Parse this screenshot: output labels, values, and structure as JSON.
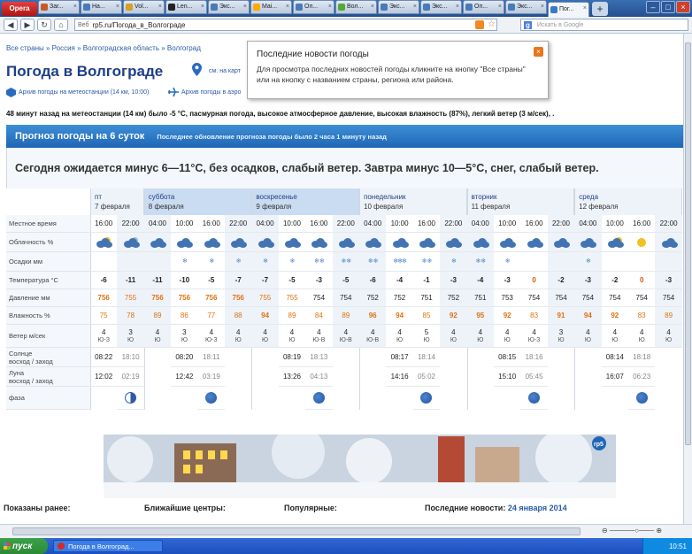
{
  "browser": {
    "menu_label": "Opera",
    "tabs": [
      {
        "label": "Заг...",
        "color": "#c65a2a"
      },
      {
        "label": "На...",
        "color": "#4a7ab8"
      },
      {
        "label": "Vol...",
        "color": "#d8a020"
      },
      {
        "label": "Len...",
        "color": "#222222"
      },
      {
        "label": "Экс...",
        "color": "#4a7ab8"
      },
      {
        "label": "Mai...",
        "color": "#ffaa00"
      },
      {
        "label": "Оп...",
        "color": "#4a7ab8"
      },
      {
        "label": "Вол...",
        "color": "#55aa33"
      },
      {
        "label": "Экс...",
        "color": "#4a7ab8"
      },
      {
        "label": "Экс...",
        "color": "#4a7ab8"
      },
      {
        "label": "Оп...",
        "color": "#4a7ab8"
      },
      {
        "label": "Экс...",
        "color": "#4a7ab8"
      },
      {
        "label": "Пог...",
        "color": "#3a7bc8",
        "active": true
      }
    ],
    "url_prefix": "Веб",
    "url": "rp5.ru/Погода_в_Волгограде",
    "search_engine": "g",
    "search_placeholder": "Искать в Google"
  },
  "breadcrumb": "Все страны » Россия » Волгоградская область » Волгоград",
  "page_title": "Погода в Волгограде",
  "map_link": "см. на карт",
  "archive_link": "Архив погоды на метеостанции (14 км, 10:00)",
  "archive_link2": "Архив погоды в аэро",
  "popup": {
    "title": "Последние новости погоды",
    "body": "Для просмотра последних новостей погоды кликните на кнопку \"Все страны\" или на кнопку с названием страны, региона или района.",
    "close": "×"
  },
  "observation": "48 минут назад на метеостанции (14 км) было -5 °С, пасмурная погода, высокое атмосферное давление, высокая влажность (87%), легкий ветер (3 м/сек), .",
  "forecast_header": {
    "title": "Прогноз погоды на 6 суток",
    "updated": "Последнее обновление прогноза погоды было 2 часа 1 минуту назад"
  },
  "today_summary": "Сегодня ожидается минус 6—11°С, без осадков, слабый ветер. Завтра минус 10—5°С, снег, слабый ветер.",
  "row_labels": {
    "time": "Местное время",
    "cloud": "Облачность %",
    "precip": "Осадки мм",
    "temp": "Температура °C",
    "pressure": "Давление мм",
    "humidity": "Влажность %",
    "wind": "Ветер м/сек",
    "sun": "Солнце\nвосход / заход",
    "moon": "Луна\nвосход / заход",
    "phase": "фаза"
  },
  "days": [
    {
      "name": "пт",
      "date": "7 февраля",
      "highlight": false
    },
    {
      "name": "суббота",
      "date": "8 февраля",
      "highlight": true
    },
    {
      "name": "воскресенье",
      "date": "9 февраля",
      "highlight": true
    },
    {
      "name": "понедельник",
      "date": "10 февраля",
      "highlight": false
    },
    {
      "name": "вторник",
      "date": "11 февраля",
      "highlight": false
    },
    {
      "name": "среда",
      "date": "12 февраля",
      "highlight": false
    }
  ],
  "columns": [
    {
      "time": "16:00",
      "temp": "-6",
      "p": "756",
      "h": "75",
      "w": "4",
      "wd": "Ю-З",
      "night": false,
      "snow": 0,
      "cloud": "sun"
    },
    {
      "time": "22:00",
      "temp": "-11",
      "p": "755",
      "h": "78",
      "w": "3",
      "wd": "Ю",
      "night": true,
      "snow": 0,
      "cloud": "moon"
    },
    {
      "time": "04:00",
      "temp": "-11",
      "p": "756",
      "h": "89",
      "w": "4",
      "wd": "Ю",
      "night": true,
      "snow": 0,
      "cloud": "full"
    },
    {
      "time": "10:00",
      "temp": "-10",
      "p": "756",
      "h": "86",
      "w": "3",
      "wd": "Ю",
      "night": false,
      "snow": 1,
      "cloud": "full"
    },
    {
      "time": "16:00",
      "temp": "-5",
      "p": "756",
      "h": "77",
      "w": "4",
      "wd": "Ю-З",
      "night": false,
      "snow": 1,
      "cloud": "full"
    },
    {
      "time": "22:00",
      "temp": "-7",
      "p": "756",
      "h": "88",
      "w": "4",
      "wd": "Ю",
      "night": true,
      "snow": 1,
      "cloud": "full"
    },
    {
      "time": "04:00",
      "temp": "-7",
      "p": "755",
      "h": "94",
      "w": "4",
      "wd": "Ю",
      "night": true,
      "snow": 1,
      "cloud": "full"
    },
    {
      "time": "10:00",
      "temp": "-5",
      "p": "755",
      "h": "89",
      "w": "4",
      "wd": "Ю",
      "night": false,
      "snow": 1,
      "cloud": "full"
    },
    {
      "time": "16:00",
      "temp": "-3",
      "p": "754",
      "h": "84",
      "w": "4",
      "wd": "Ю-В",
      "night": false,
      "snow": 2,
      "cloud": "full"
    },
    {
      "time": "22:00",
      "temp": "-5",
      "p": "754",
      "h": "89",
      "w": "4",
      "wd": "Ю-В",
      "night": true,
      "snow": 2,
      "cloud": "full"
    },
    {
      "time": "04:00",
      "temp": "-6",
      "p": "752",
      "h": "96",
      "w": "4",
      "wd": "Ю-В",
      "night": true,
      "snow": 2,
      "cloud": "full"
    },
    {
      "time": "10:00",
      "temp": "-4",
      "p": "752",
      "h": "94",
      "w": "4",
      "wd": "Ю",
      "night": false,
      "snow": 3,
      "cloud": "full"
    },
    {
      "time": "16:00",
      "temp": "-1",
      "p": "751",
      "h": "85",
      "w": "5",
      "wd": "Ю",
      "night": false,
      "snow": 2,
      "cloud": "full"
    },
    {
      "time": "22:00",
      "temp": "-3",
      "p": "752",
      "h": "92",
      "w": "4",
      "wd": "Ю",
      "night": true,
      "snow": 1,
      "cloud": "full"
    },
    {
      "time": "04:00",
      "temp": "-4",
      "p": "751",
      "h": "95",
      "w": "4",
      "wd": "Ю",
      "night": true,
      "snow": 2,
      "cloud": "full"
    },
    {
      "time": "10:00",
      "temp": "-3",
      "p": "753",
      "h": "92",
      "w": "4",
      "wd": "Ю",
      "night": false,
      "snow": 1,
      "cloud": "full"
    },
    {
      "time": "16:00",
      "temp": "0",
      "p": "754",
      "h": "83",
      "w": "4",
      "wd": "Ю-З",
      "night": false,
      "snow": 0,
      "cloud": "full"
    },
    {
      "time": "22:00",
      "temp": "-2",
      "p": "754",
      "h": "91",
      "w": "3",
      "wd": "Ю",
      "night": true,
      "snow": 0,
      "cloud": "full"
    },
    {
      "time": "04:00",
      "temp": "-3",
      "p": "754",
      "h": "94",
      "w": "4",
      "wd": "Ю",
      "night": true,
      "snow": 1,
      "cloud": "full"
    },
    {
      "time": "10:00",
      "temp": "-2",
      "p": "754",
      "h": "92",
      "w": "4",
      "wd": "Ю",
      "night": false,
      "snow": 0,
      "cloud": "sun"
    },
    {
      "time": "16:00",
      "temp": "0",
      "p": "754",
      "h": "83",
      "w": "4",
      "wd": "Ю",
      "night": false,
      "snow": 0,
      "cloud": "sunny"
    },
    {
      "time": "22:00",
      "temp": "-3",
      "p": "754",
      "h": "89",
      "w": "4",
      "wd": "Ю",
      "night": true,
      "snow": 0,
      "cloud": "full"
    }
  ],
  "sun": [
    {
      "rise": "08:22",
      "set": "18:10"
    },
    {
      "rise": "08:20",
      "set": "18:11"
    },
    {
      "rise": "08:19",
      "set": "18:13"
    },
    {
      "rise": "08:17",
      "set": "18:14"
    },
    {
      "rise": "08:15",
      "set": "18:16"
    },
    {
      "rise": "08:14",
      "set": "18:18"
    }
  ],
  "moon": [
    {
      "rise": "12:02",
      "set": "02:19",
      "phase": "half"
    },
    {
      "rise": "12:42",
      "set": "03:19",
      "phase": "full"
    },
    {
      "rise": "13:26",
      "set": "04:13",
      "phase": "full"
    },
    {
      "rise": "14:16",
      "set": "05:02",
      "phase": "full"
    },
    {
      "rise": "15:10",
      "set": "05:45",
      "phase": "full"
    },
    {
      "rise": "16:07",
      "set": "06:23",
      "phase": "full"
    }
  ],
  "bottom": {
    "shown_before": "Показаны ранее:",
    "centers": "Ближайшие центры:",
    "popular": "Популярные:",
    "news": "Последние новости:",
    "news_date": "24 января 2014"
  },
  "banner_logo": "rp5",
  "taskbar": {
    "start": "пуск",
    "window": "Погода в Волгоград...",
    "clock": "10:51"
  },
  "colors": {
    "accent": "#1f66b6",
    "link": "#2a5aa8",
    "pressure": "#e0720e",
    "humidity": "#e0720e",
    "temp_zero": "#e0520e"
  }
}
